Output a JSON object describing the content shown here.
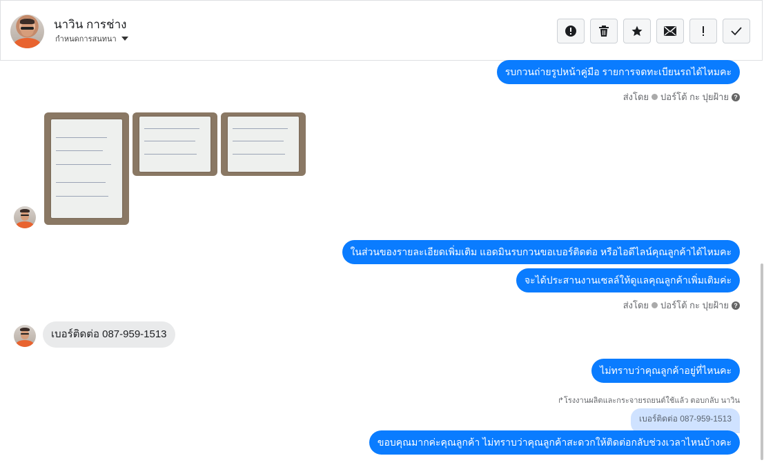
{
  "header": {
    "contact_name": "นาวิน การช่าง",
    "subtitle": "กำหนดการสนทนา",
    "actions": [
      {
        "icon": "alert-circle-icon",
        "glyph": "❗"
      },
      {
        "icon": "trash-icon",
        "glyph": "🗑"
      },
      {
        "icon": "star-icon",
        "glyph": "★"
      },
      {
        "icon": "envelope-icon",
        "glyph": "✉"
      },
      {
        "icon": "exclamation-icon",
        "glyph": "!"
      },
      {
        "icon": "check-icon",
        "glyph": "✓"
      }
    ]
  },
  "messages": {
    "m1": "รบกวนถ่ายรูปหน้าคู่มือ รายการจดทะเบียนรถได้ไหมคะ",
    "sent_by_1": "ส่งโดย",
    "sender_1": "ปอร์โต้ กะ ปุยฝ้าย",
    "m2": "ในส่วนของรายละเอียดเพิ่มเติม แอดมินรบกวนขอเบอร์ติดต่อ หรือไอดีไลน์คุณลูกค้าได้ไหมคะ",
    "m3": "จะได้ประสานงานเซลล์ให้ดูแลคุณลูกค้าเพิ่มเติมค่ะ",
    "sent_by_2": "ส่งโดย",
    "sender_2": "ปอร์โต้ กะ ปุยฝ้าย",
    "in1": "เบอร์ติดต่อ 087-959-1513",
    "m4": "ไม่ทราบว่าคุณลูกค้าอยู่ที่ไหนคะ",
    "reply_meta": "โรงงานผลิตและกระจายรถยนต์ใช้แล้ว ตอบกลับ นาวิน",
    "quote": "เบอร์ติดต่อ 087-959-1513",
    "m5": "ขอบคุณมากค่ะคุณลูกค้า ไม่ทราบว่าคุณลูกค้าสะดวกให้ติดต่อกลับช่วงเวลาไหนบ้างคะ"
  },
  "colors": {
    "outgoing": "#0a7cff",
    "incoming": "#e9eaeb",
    "quote": "#cfe2ff"
  }
}
